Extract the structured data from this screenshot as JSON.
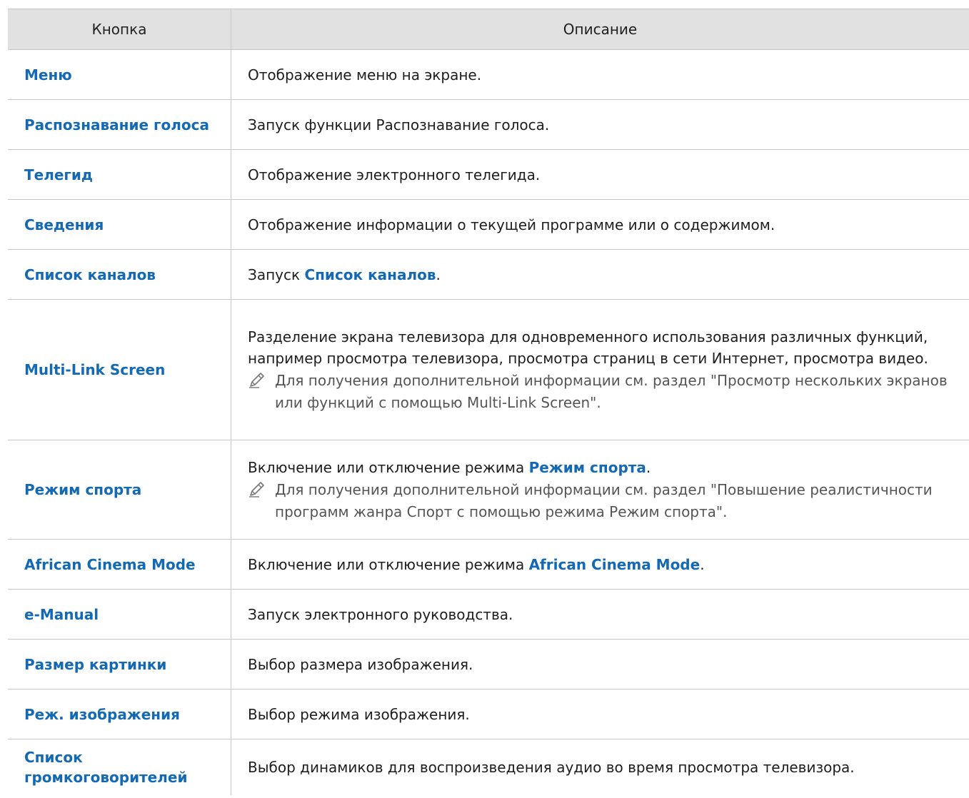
{
  "header": {
    "col_button": "Кнопка",
    "col_description": "Описание"
  },
  "rows": [
    {
      "button": "Меню",
      "desc": "Отображение меню на экране."
    },
    {
      "button": "Распознавание голоса",
      "desc": "Запуск функции Распознавание голоса."
    },
    {
      "button": "Телегид",
      "desc": "Отображение электронного телегида."
    },
    {
      "button": "Сведения",
      "desc": "Отображение информации о текущей программе или о содержимом."
    },
    {
      "button": "Список каналов",
      "desc_prefix": "Запуск ",
      "desc_highlight": "Список каналов",
      "desc_suffix": "."
    },
    {
      "button": "Multi-Link Screen",
      "desc": "Разделение экрана телевизора для одновременного использования различных функций, например просмотра телевизора, просмотра страниц в сети Интернет, просмотра видео.",
      "note": "Для получения дополнительной информации см. раздел \"Просмотр нескольких экранов или функций с помощью Multi-Link Screen\"."
    },
    {
      "button": "Режим спорта",
      "desc_prefix": "Включение или отключение режима ",
      "desc_highlight": "Режим спорта",
      "desc_suffix": ".",
      "note": "Для получения дополнительной информации см. раздел \"Повышение реалистичности программ жанра Спорт с помощью режима Режим спорта\"."
    },
    {
      "button": "African Cinema Mode",
      "desc_prefix": "Включение или отключение режима ",
      "desc_highlight": "African Cinema Mode",
      "desc_suffix": "."
    },
    {
      "button": "e-Manual",
      "desc": "Запуск электронного руководства."
    },
    {
      "button": "Размер картинки",
      "desc": "Выбор размера изображения."
    },
    {
      "button": "Реж. изображения",
      "desc": "Выбор режима изображения."
    },
    {
      "button": "Список громкоговорителей",
      "desc": "Выбор динамиков для воспроизведения аудио во время просмотра телевизора."
    }
  ],
  "icons": {
    "note": "pencil-note-icon"
  },
  "colors": {
    "accent": "#1469b4",
    "header_bg": "#e1e1e1",
    "border": "#c8c8c8"
  }
}
